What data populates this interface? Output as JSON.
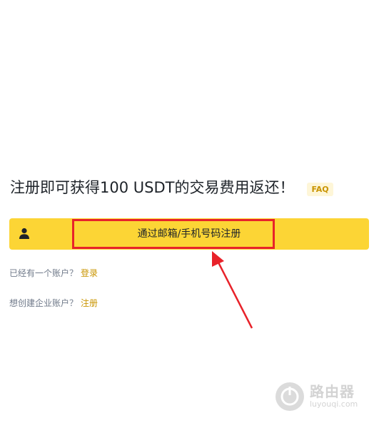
{
  "heading": {
    "text": "注册即可获得100 USDT的交易费用返还！",
    "faq_label": "FAQ"
  },
  "register_button": {
    "label": "通过邮箱/手机号码注册",
    "icon": "user-icon",
    "color": "#fcd535"
  },
  "login_row": {
    "prompt": "已经有一个账户？",
    "link": "登录"
  },
  "business_row": {
    "prompt": "想创建企业账户？",
    "link": "注册"
  },
  "annotation": {
    "color": "#e8222a"
  },
  "watermark": {
    "cn": "路由器",
    "en": "luyouqi.com"
  }
}
